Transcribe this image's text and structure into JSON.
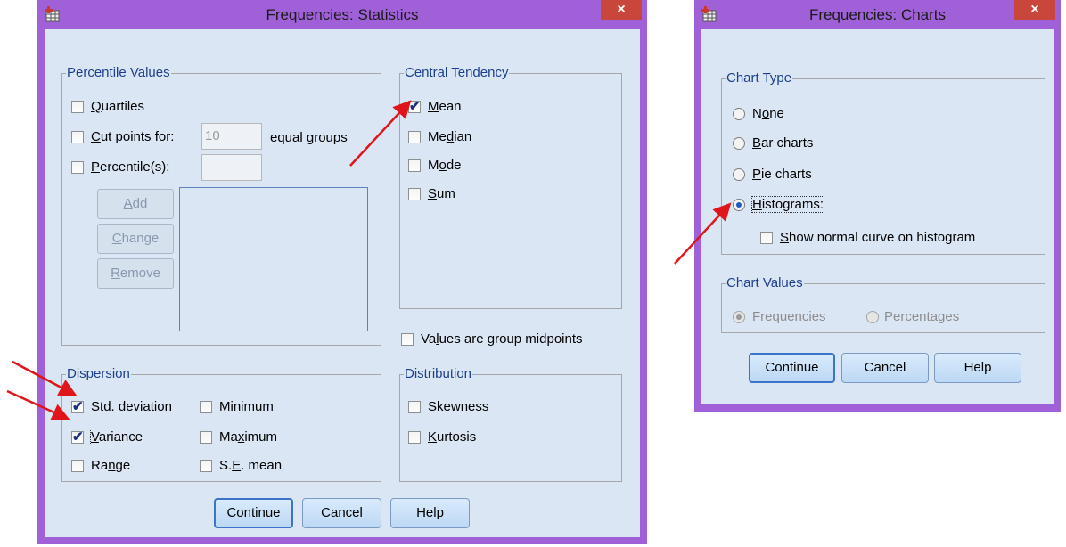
{
  "statistics_dialog": {
    "title": "Frequencies: Statistics",
    "close_glyph": "×",
    "percentile_values": {
      "legend": "Percentile Values",
      "quartiles": {
        "u": "Q",
        "rest": "uartiles",
        "checked": false
      },
      "cut_points": {
        "u": "C",
        "rest": "ut points for:",
        "checked": false,
        "value": "10",
        "suffix": "equal groups"
      },
      "percentiles": {
        "u": "P",
        "rest": "ercentile(s):",
        "checked": false,
        "value": ""
      },
      "add": {
        "u": "A",
        "rest": "dd"
      },
      "change": {
        "u": "C",
        "rest": "hange"
      },
      "remove": {
        "u": "R",
        "rest": "emove"
      }
    },
    "central_tendency": {
      "legend": "Central Tendency",
      "mean": {
        "u": "M",
        "rest": "ean",
        "checked": true
      },
      "median": {
        "pre": "Me",
        "u": "d",
        "rest": "ian",
        "checked": false
      },
      "mode": {
        "pre": "M",
        "u": "o",
        "rest": "de",
        "checked": false
      },
      "sum": {
        "u": "S",
        "rest": "um",
        "checked": false
      }
    },
    "group_midpoints": {
      "pre": "Va",
      "u": "l",
      "rest": "ues are group midpoints",
      "checked": false
    },
    "dispersion": {
      "legend": "Dispersion",
      "std_deviation": {
        "pre": "S",
        "u": "t",
        "rest": "d. deviation",
        "checked": true
      },
      "minimum": {
        "pre": "M",
        "u": "i",
        "rest": "nimum",
        "checked": false
      },
      "variance": {
        "u": "V",
        "rest": "ariance",
        "checked": true
      },
      "maximum": {
        "pre": "Ma",
        "u": "x",
        "rest": "imum",
        "checked": false
      },
      "range": {
        "pre": "Ra",
        "u": "n",
        "rest": "ge",
        "checked": false
      },
      "se_mean": {
        "pre": "S.",
        "u": "E",
        "rest": ". mean",
        "checked": false
      }
    },
    "distribution": {
      "legend": "Distribution",
      "skewness": {
        "pre": "S",
        "u": "k",
        "rest": "ewness",
        "checked": false
      },
      "kurtosis": {
        "u": "K",
        "rest": "urtosis",
        "checked": false
      }
    },
    "buttons": {
      "continue": "Continue",
      "cancel": "Cancel",
      "help": "Help"
    }
  },
  "charts_dialog": {
    "title": "Frequencies: Charts",
    "close_glyph": "×",
    "chart_type": {
      "legend": "Chart Type",
      "none": {
        "pre": "N",
        "u": "o",
        "rest": "ne",
        "selected": false
      },
      "bar_charts": {
        "u": "B",
        "rest": "ar charts",
        "selected": false
      },
      "pie_charts": {
        "u": "P",
        "rest": "ie charts",
        "selected": false
      },
      "histograms": {
        "u": "H",
        "rest": "istograms:",
        "selected": true
      },
      "normal_curve": {
        "u": "S",
        "rest": "how normal curve on histogram",
        "checked": false
      }
    },
    "chart_values": {
      "legend": "Chart Values",
      "frequencies": {
        "u": "F",
        "rest": "requencies",
        "selected": true
      },
      "percentages": {
        "pre": "Per",
        "u": "c",
        "rest": "entages",
        "selected": false
      }
    },
    "buttons": {
      "continue": "Continue",
      "cancel": "Cancel",
      "help": "Help"
    }
  },
  "colors": {
    "title_bar": "#a061d8",
    "client_bg": "#dbe6f4",
    "group_label": "#1b3f8c",
    "close": "#c9463c",
    "arrow": "#e0141b"
  }
}
